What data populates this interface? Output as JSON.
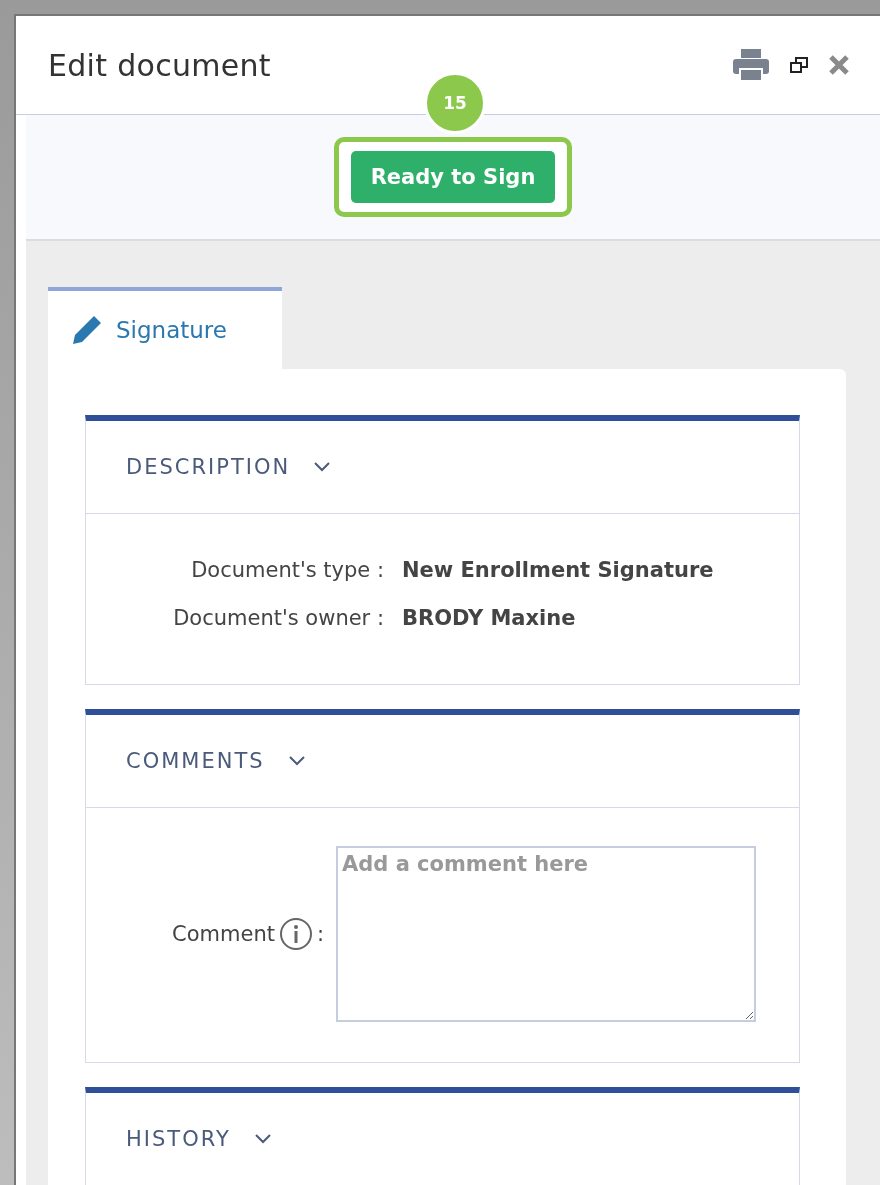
{
  "window": {
    "title": "Edit document"
  },
  "callout": {
    "number": "15"
  },
  "toolbar": {
    "primary_button": "Ready to Sign"
  },
  "tabs": [
    {
      "label": "Signature",
      "selected": true
    }
  ],
  "sections": [
    {
      "kind": "fields",
      "title": "DESCRIPTION",
      "fields": [
        {
          "label": "Document's type :",
          "value": "New Enrollment Signature"
        },
        {
          "label": "Document's owner :",
          "value": "BRODY Maxine"
        }
      ]
    },
    {
      "kind": "comment",
      "title": "COMMENTS",
      "label": "Comment",
      "separator": ":",
      "placeholder": "Add a comment here"
    },
    {
      "kind": "collapsed",
      "title": "HISTORY"
    }
  ]
}
